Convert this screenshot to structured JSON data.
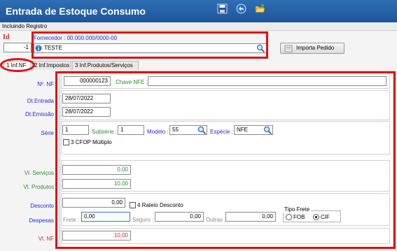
{
  "window": {
    "title": "Entrada de Estoque Consumo",
    "mode": "Incluindo Registro"
  },
  "toolbar": {
    "icons": [
      "save-icon",
      "undo-icon",
      "open-folder-icon"
    ]
  },
  "header": {
    "id_label": "Id",
    "id_value": "-1",
    "fornecedor_label": "Fornecedor : 00.000.000/0000-00",
    "fornecedor_value": "TESTE",
    "importa_label": "Importa Pedido"
  },
  "tabs": [
    {
      "label": "1 Inf.NF",
      "active": true
    },
    {
      "label": "2 Inf.Impostos",
      "active": false
    },
    {
      "label": "3 Inf.Produtos/Serviços",
      "active": false
    }
  ],
  "form": {
    "nf_label": "Nº. NF",
    "nf_value": "000000123",
    "chave_label": "Chave NFE :",
    "chave_value": "",
    "dt_entrada_label": "Dt.Entrada",
    "dt_entrada_value": "28/07/2022",
    "dt_emissao_label": "Dt.Emissão",
    "dt_emissao_value": "28/07/2022",
    "serie_label": "Série",
    "serie_value": "1",
    "subserie_label": "Subsérie :",
    "subserie_value": "1",
    "modelo_label": "Modelo :",
    "modelo_value": "55",
    "especie_label": "Espécie :",
    "especie_value": "NFE",
    "cfop_label": "3 CFOP Múltiplo",
    "vl_servicos_label": "Vl. Serviços",
    "vl_servicos_value": "0,00",
    "vl_produtos_label": "Vl. Produtos",
    "vl_produtos_value": "10,00",
    "desconto_label": "Desconto",
    "desconto_value": "0,00",
    "rateio_label": "4 Rateio Desconto",
    "despesas_label": "Despesas",
    "frete_label": "Frete :",
    "frete_value": "0,00",
    "seguro_label": "Seguro :",
    "seguro_value": "0,00",
    "outras_label": "Outras :",
    "outras_value": "0,00",
    "tipo_frete_label": "Tipo Frete",
    "fob_label": "FOB",
    "cif_label": "CIF",
    "tipo_frete_selected": "CIF",
    "vl_nf_label": "Vl. NF",
    "vl_nf_value": "10,00"
  },
  "colors": {
    "titlebar": "#1e5596",
    "label_blue": "#1d2fd6",
    "value_green": "#2e8b2e",
    "value_red": "#d42a2a",
    "highlight": "#e01010"
  }
}
